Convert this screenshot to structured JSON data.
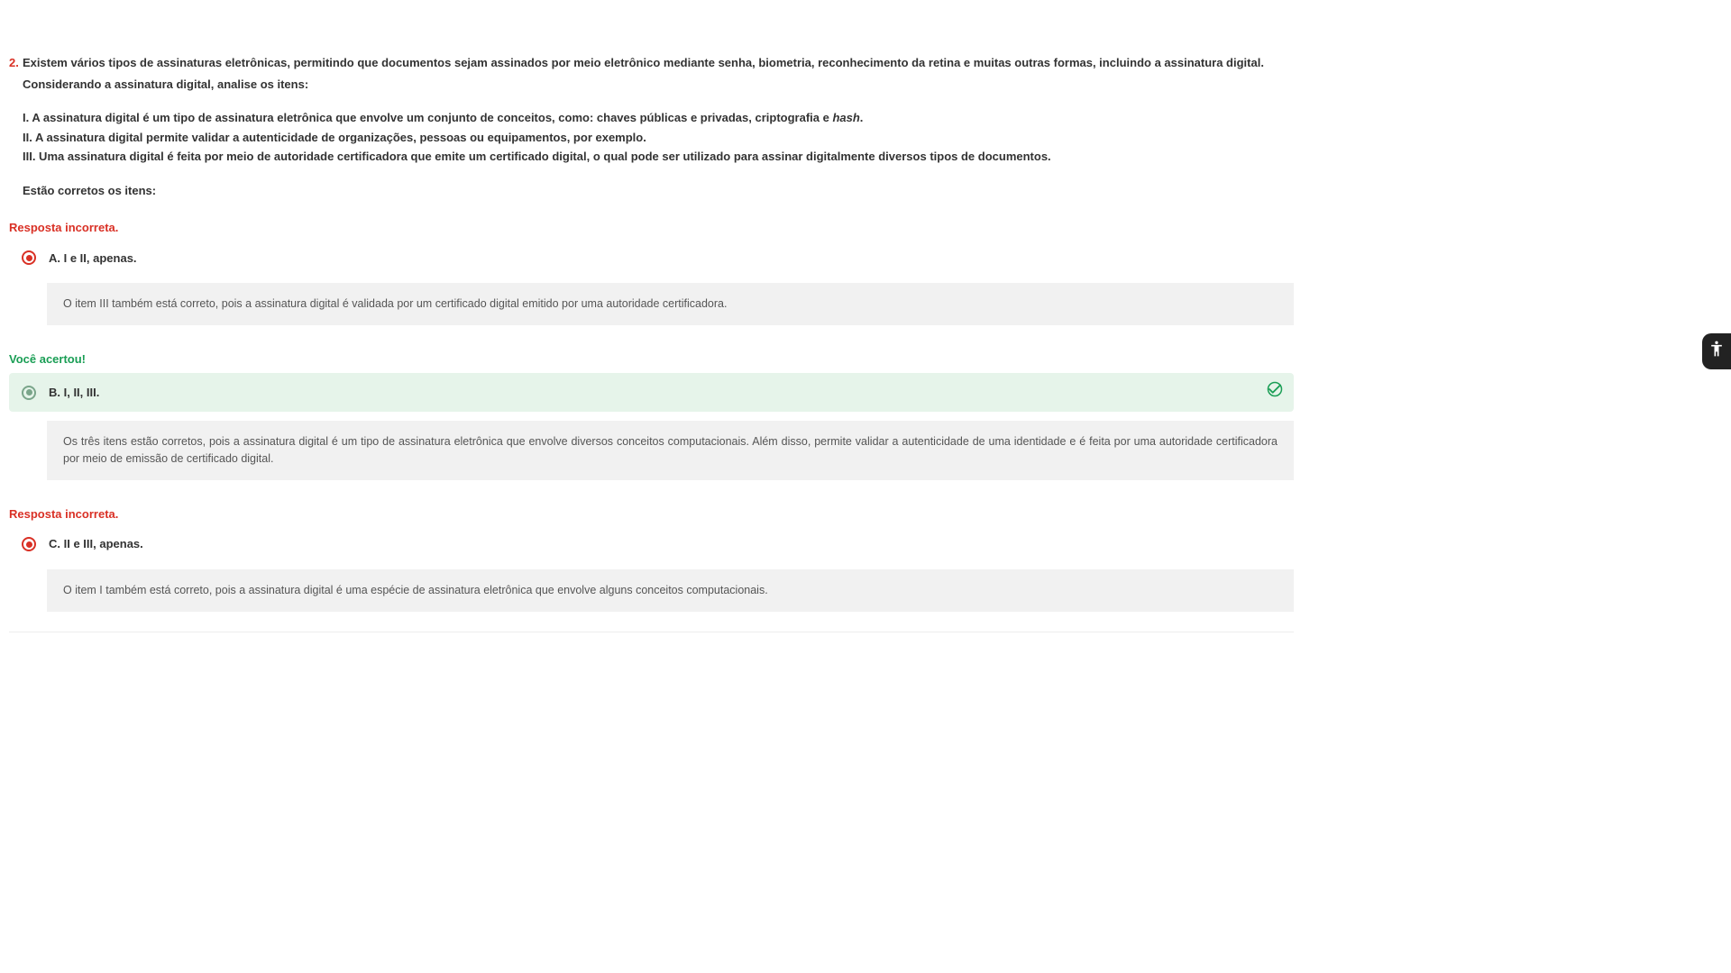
{
  "question": {
    "number": "2.",
    "intro": "Existem vários tipos de assinaturas eletrônicas, permitindo que documentos sejam assinados por meio eletrônico mediante senha, biometria, reconhecimento da retina e muitas outras formas, incluindo a assinatura digital.",
    "consider": "Considerando a assinatura digital, analise os itens:",
    "item_i_pre": "I. A assinatura digital é um tipo de assinatura eletrônica que envolve um conjunto de conceitos, como: chaves públicas e privadas, criptografia e ",
    "item_i_em": "hash",
    "item_i_post": ".",
    "item_ii": "II. A assinatura digital permite validar a autenticidade de organizações, pessoas ou equipamentos, por exemplo.",
    "item_iii": "III. Uma assinatura digital é feita por meio de autoridade certificadora que emite um certificado digital, o qual pode ser utilizado para assinar digitalmente diversos tipos de documentos.",
    "final": "Estão corretos os itens:"
  },
  "labels": {
    "incorrect": "Resposta incorreta.",
    "correct": "Você acertou!"
  },
  "options": {
    "a": {
      "label": "A. I e II, apenas.",
      "explanation": "O item III também está correto, pois a assinatura digital é validada por um certificado digital emitido por uma autoridade certificadora."
    },
    "b": {
      "label": "B. I, II, III.",
      "explanation": "Os três itens estão corretos, pois a assinatura digital é um tipo de assinatura eletrônica que envolve diversos conceitos computacionais. Além disso, permite validar a autenticidade de uma identidade e é feita por uma autoridade certificadora por meio de emissão de certificado digital."
    },
    "c": {
      "label": "C. II e III, apenas.",
      "explanation": "O item I também está correto, pois a assinatura digital é uma espécie de assinatura eletrônica que envolve alguns conceitos computacionais."
    }
  }
}
